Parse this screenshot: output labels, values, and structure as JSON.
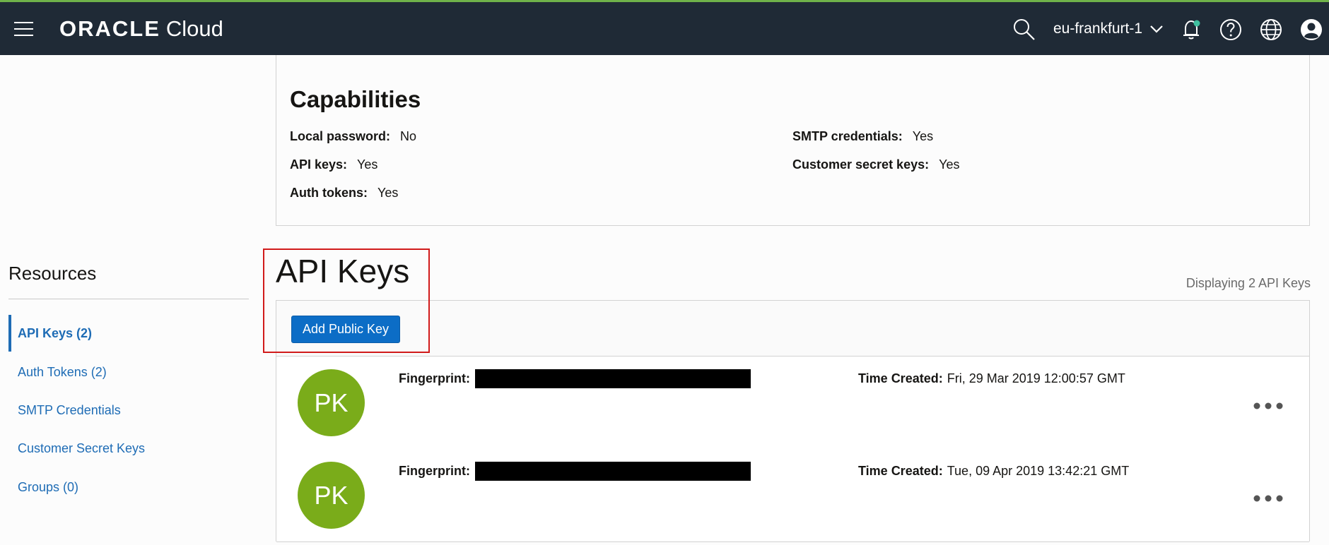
{
  "topbar": {
    "brand": "ORACLE",
    "brand_suffix": "Cloud",
    "region": "eu-frankfurt-1",
    "icons": [
      "menu-icon",
      "search-icon",
      "chevron-down-icon",
      "bell-icon",
      "help-icon",
      "globe-icon",
      "user-icon"
    ],
    "accent_color": "#6fb24a",
    "background_color": "#1f2a36"
  },
  "capabilities": {
    "title": "Capabilities",
    "items": [
      {
        "label": "Local password:",
        "value": "No"
      },
      {
        "label": "SMTP credentials:",
        "value": "Yes"
      },
      {
        "label": "API keys:",
        "value": "Yes"
      },
      {
        "label": "Customer secret keys:",
        "value": "Yes"
      },
      {
        "label": "Auth tokens:",
        "value": "Yes"
      }
    ]
  },
  "resources": {
    "title": "Resources",
    "items": [
      {
        "label": "API Keys (2)",
        "active": true
      },
      {
        "label": "Auth Tokens (2)"
      },
      {
        "label": "SMTP Credentials"
      },
      {
        "label": "Customer Secret Keys"
      },
      {
        "label": "Groups (0)"
      }
    ],
    "link_color": "#1e6cb5"
  },
  "api_keys": {
    "title": "API Keys",
    "count_text": "Displaying 2 API Keys",
    "add_button": "Add Public Key",
    "rows": [
      {
        "avatar": "PK",
        "fingerprint_label": "Fingerprint:",
        "time_label": "Time Created:",
        "time_value": "Fri, 29 Mar 2019 12:00:57 GMT"
      },
      {
        "avatar": "PK",
        "fingerprint_label": "Fingerprint:",
        "time_label": "Time Created:",
        "time_value": "Tue, 09 Apr 2019 13:42:21 GMT"
      }
    ],
    "avatar_color": "#7aac1a",
    "button_color": "#0c6dc6"
  }
}
